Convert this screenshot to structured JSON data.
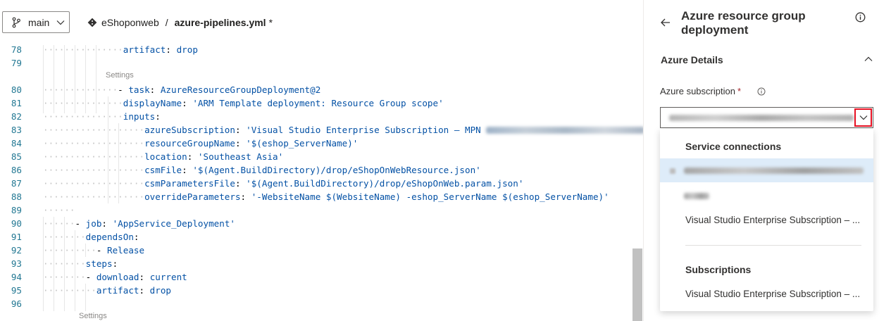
{
  "topbar": {
    "branch": "main",
    "repo": "eShoponweb",
    "separator": "/",
    "file": "azure-pipelines.yml",
    "modified_marker": "*"
  },
  "editor": {
    "codelens_label": "Settings",
    "lines": [
      {
        "n": "78",
        "segs": [
          [
            "k",
            "artifact"
          ],
          [
            "p",
            ": "
          ],
          [
            "s",
            "drop"
          ]
        ]
      },
      {
        "n": "79",
        "segs": []
      },
      {
        "n": "80",
        "segs": [
          [
            "p",
            "- "
          ],
          [
            "k",
            "task"
          ],
          [
            "p",
            ": "
          ],
          [
            "s",
            "AzureResourceGroupDeployment@2"
          ]
        ]
      },
      {
        "n": "81",
        "segs": [
          [
            "k",
            "displayName"
          ],
          [
            "p",
            ": "
          ],
          [
            "s",
            "'ARM Template deployment: Resource Group scope'"
          ]
        ]
      },
      {
        "n": "82",
        "segs": [
          [
            "k",
            "inputs"
          ],
          [
            "p",
            ":"
          ]
        ]
      },
      {
        "n": "83",
        "segs": [
          [
            "k",
            "azureSubscription"
          ],
          [
            "p",
            ": "
          ],
          [
            "s",
            "'Visual Studio Enterprise Subscription – MPN"
          ]
        ]
      },
      {
        "n": "84",
        "segs": [
          [
            "k",
            "resourceGroupName"
          ],
          [
            "p",
            ": "
          ],
          [
            "s",
            "'$(eshop_ServerName)'"
          ]
        ]
      },
      {
        "n": "85",
        "segs": [
          [
            "k",
            "location"
          ],
          [
            "p",
            ": "
          ],
          [
            "s",
            "'Southeast Asia'"
          ]
        ]
      },
      {
        "n": "86",
        "segs": [
          [
            "k",
            "csmFile"
          ],
          [
            "p",
            ": "
          ],
          [
            "s",
            "'$(Agent.BuildDirectory)/drop/eShopOnWebResource.json'"
          ]
        ]
      },
      {
        "n": "87",
        "segs": [
          [
            "k",
            "csmParametersFile"
          ],
          [
            "p",
            ": "
          ],
          [
            "s",
            "'$(Agent.BuildDirectory)/drop/eShopOnWeb.param.json'"
          ]
        ]
      },
      {
        "n": "88",
        "segs": [
          [
            "k",
            "overrideParameters"
          ],
          [
            "p",
            ": "
          ],
          [
            "s",
            "'-WebsiteName $(WebsiteName) -eshop_ServerName $(eshop_ServerName)'"
          ]
        ]
      },
      {
        "n": "89",
        "segs": []
      },
      {
        "n": "90",
        "segs": [
          [
            "p",
            "- "
          ],
          [
            "k",
            "job"
          ],
          [
            "p",
            ": "
          ],
          [
            "s",
            "'AppService_Deployment'"
          ]
        ]
      },
      {
        "n": "91",
        "segs": [
          [
            "k",
            "dependsOn"
          ],
          [
            "p",
            ":"
          ]
        ]
      },
      {
        "n": "92",
        "segs": [
          [
            "p",
            "- "
          ],
          [
            "s",
            "Release"
          ]
        ]
      },
      {
        "n": "93",
        "segs": [
          [
            "k",
            "steps"
          ],
          [
            "p",
            ":"
          ]
        ]
      },
      {
        "n": "94",
        "segs": [
          [
            "p",
            "- "
          ],
          [
            "k",
            "download"
          ],
          [
            "p",
            ": "
          ],
          [
            "s",
            "current"
          ]
        ]
      },
      {
        "n": "95",
        "segs": [
          [
            "k",
            "artifact"
          ],
          [
            "p",
            ": "
          ],
          [
            "s",
            "drop"
          ]
        ]
      },
      {
        "n": "96",
        "segs": []
      }
    ]
  },
  "panel": {
    "title": "Azure resource group deployment",
    "section": "Azure Details",
    "field_label": "Azure subscription",
    "required_marker": "*",
    "dropdown": {
      "header_connections": "Service connections",
      "item_visual_studio_1": "Visual Studio Enterprise Subscription – ...",
      "header_subscriptions": "Subscriptions",
      "item_visual_studio_2": "Visual Studio Enterprise Subscription – ..."
    }
  },
  "colors": {
    "keyword": "#0451a5",
    "line_number": "#237893",
    "highlight_border": "#e81123",
    "selected_item": "#deecf9"
  }
}
